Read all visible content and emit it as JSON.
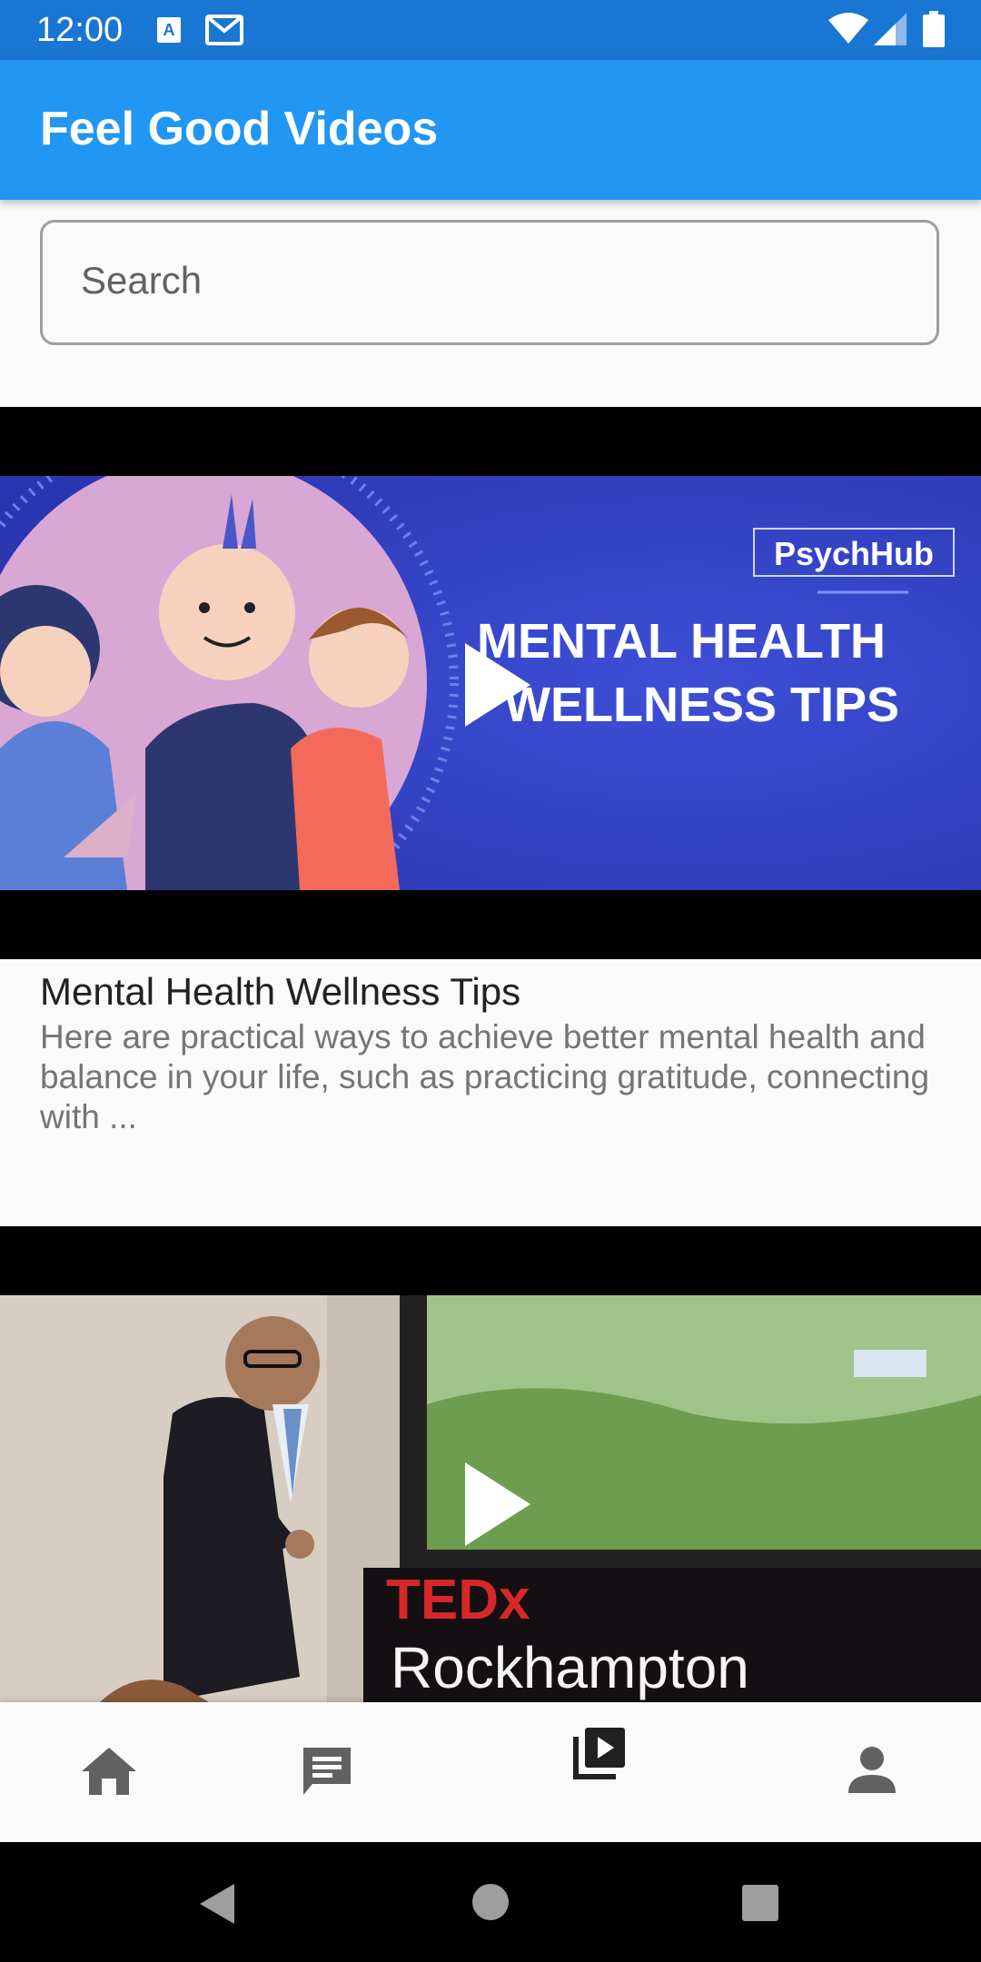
{
  "status_bar": {
    "time": "12:00",
    "icons": [
      "keyboard-a-icon",
      "gmail-icon",
      "wifi-icon",
      "signal-icon",
      "battery-icon"
    ]
  },
  "app_bar": {
    "title": "Feel Good Videos",
    "color": "#2196f3"
  },
  "search": {
    "placeholder": "Search"
  },
  "videos": [
    {
      "thumbnail_text": {
        "brand": "PsychHub",
        "line1": "MENTAL HEALTH",
        "line2": "WELLNESS TIPS"
      },
      "title": "Mental Health Wellness Tips",
      "description": "Here are practical ways to achieve better mental health and balance in your life, such as practicing gratitude, connecting with ..."
    },
    {
      "thumbnail_text": {
        "brand": "TEDx",
        "line1": "Rockhampton"
      }
    }
  ],
  "bottom_nav": {
    "items": [
      "home-icon",
      "chat-icon",
      "video-library-icon",
      "person-icon"
    ],
    "active": "video-library-icon"
  },
  "system_nav": [
    "back-icon",
    "home-circle-icon",
    "recents-icon"
  ]
}
